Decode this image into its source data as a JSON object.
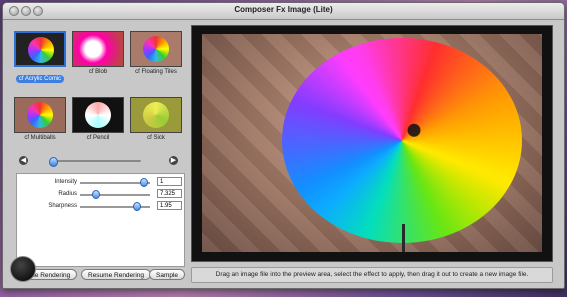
{
  "window": {
    "title": "Composer Fx Image (Lite)"
  },
  "effects": [
    {
      "label": "cf Acrylic Comic",
      "selected": true
    },
    {
      "label": "cf Blob",
      "selected": false
    },
    {
      "label": "cf Floating Tiles",
      "selected": false
    },
    {
      "label": "cf Multiballs",
      "selected": false
    },
    {
      "label": "cf Pencil",
      "selected": false
    },
    {
      "label": "cf Sick",
      "selected": false
    }
  ],
  "nav": {
    "prev_icon": "◀",
    "next_icon": "▶"
  },
  "params": [
    {
      "label": "Intensity",
      "value": "1",
      "fraction": 0.88
    },
    {
      "label": "Radius",
      "value": "7.325",
      "fraction": 0.18
    },
    {
      "label": "Sharpness",
      "value": "1.95",
      "fraction": 0.78
    }
  ],
  "buttons": {
    "pause": "Pause Rendering",
    "resume": "Resume Rendering",
    "sample": "Sample"
  },
  "status": "Drag an image file into the preview area, select the effect to apply, then drag it out to create a new image file.",
  "accent": "#3d7fe0"
}
